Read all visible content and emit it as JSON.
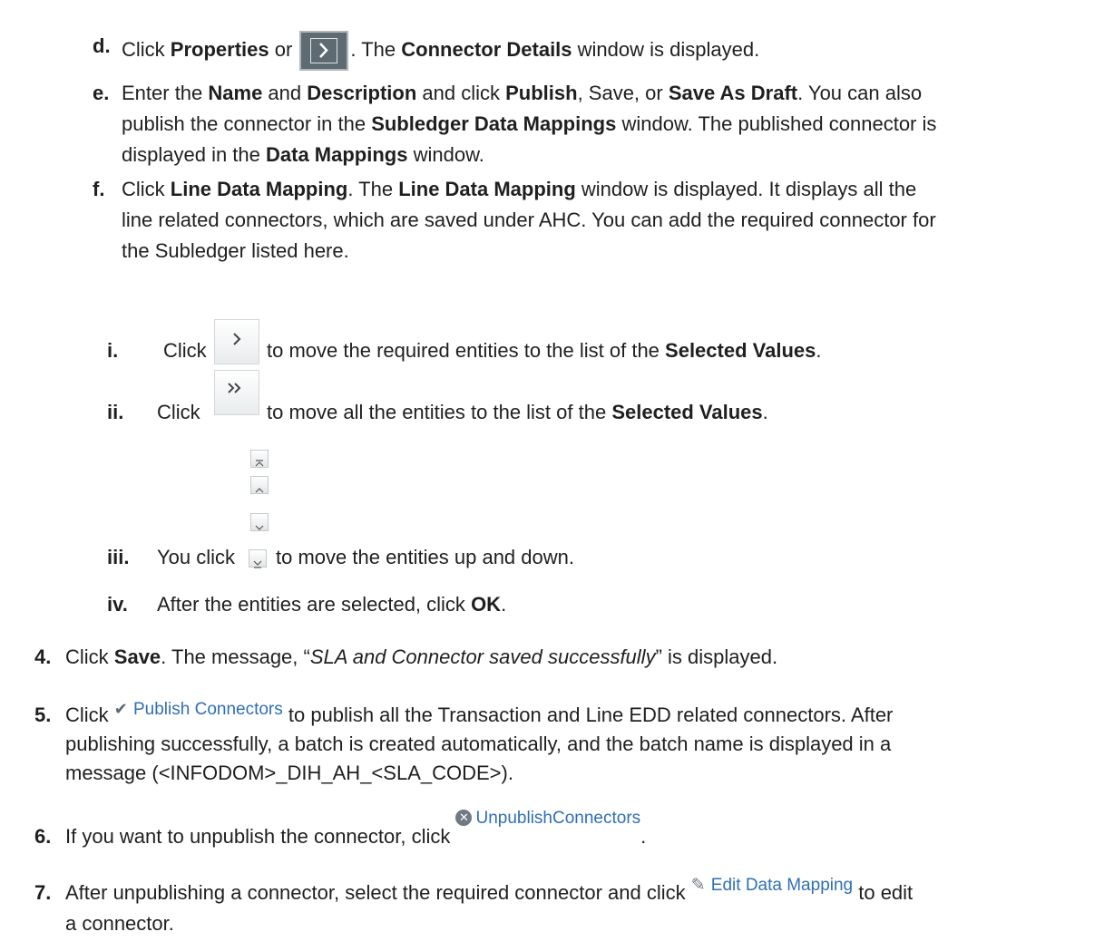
{
  "steps": {
    "d": {
      "marker": "d.",
      "click": "Click ",
      "properties": "Properties",
      "or": " or ",
      "after_icon": ". The ",
      "connector_details": "Connector Details",
      "tail": " window is displayed."
    },
    "e": {
      "marker": "e.",
      "l1_a": "Enter the ",
      "name": "Name",
      "l1_b": " and ",
      "description": "Description",
      "l1_c": " and click ",
      "publish": "Publish",
      "l1_d": ", Save, or ",
      "save_as_draft": "Save As Draft",
      "l1_e": ". You can also",
      "l2_a": "publish the connector in the ",
      "subledger_data_mappings": "Subledger Data Mappings",
      "l2_b": " window. The published connector is",
      "l3_a": "displayed in the ",
      "data_mappings": "Data Mappings",
      "l3_b": " window."
    },
    "f": {
      "marker": "f.",
      "l1_a": "Click ",
      "line_data_mapping": "Line Data Mapping",
      "l1_b": ". The ",
      "line_data_mapping_2": "Line Data Mapping",
      "l1_c": " window is displayed. It displays all the",
      "l2": "line related connectors, which are saved under AHC. You can add the required connector for",
      "l3": "the Subledger listed here."
    },
    "sub_i": {
      "marker": "i.",
      "click": "Click",
      "text": "to move the required entities to the list of the ",
      "selected_values": "Selected Values",
      "end": "."
    },
    "sub_ii": {
      "marker": "ii.",
      "click": "Click",
      "text": "to move all the entities to the list of the ",
      "selected_values": "Selected Values",
      "end": "."
    },
    "sub_iii": {
      "marker": "iii.",
      "you_click": "You click",
      "text": "to move the entities up and down."
    },
    "sub_iv": {
      "marker": "iv.",
      "text": "After the entities are selected, click ",
      "ok": "OK",
      "end": "."
    },
    "step4": {
      "marker": "4.",
      "a": "Click ",
      "save": "Save",
      "b": ". The message, “",
      "msg": "SLA and Connector saved successfully",
      "c": "” is displayed."
    },
    "step5": {
      "marker": "5.",
      "click": "Click ",
      "button_label": "Publish Connectors",
      "l1": " to publish all the Transaction and Line EDD related connectors. After",
      "l2": "publishing successfully, a batch is created automatically, and the batch name is displayed in a",
      "l3": "message (<INFODOM>_DIH_AH_<SLA_CODE>)."
    },
    "step6": {
      "marker": "6.",
      "text": "If you want to unpublish the connector, click ",
      "button_label": "UnpublishConnectors",
      "end": "."
    },
    "step7": {
      "marker": "7.",
      "text": "After unpublishing a connector, select the required connector and click ",
      "button_label": "Edit Data Mapping",
      "l1_end": " to edit",
      "l2": "a connector."
    }
  }
}
